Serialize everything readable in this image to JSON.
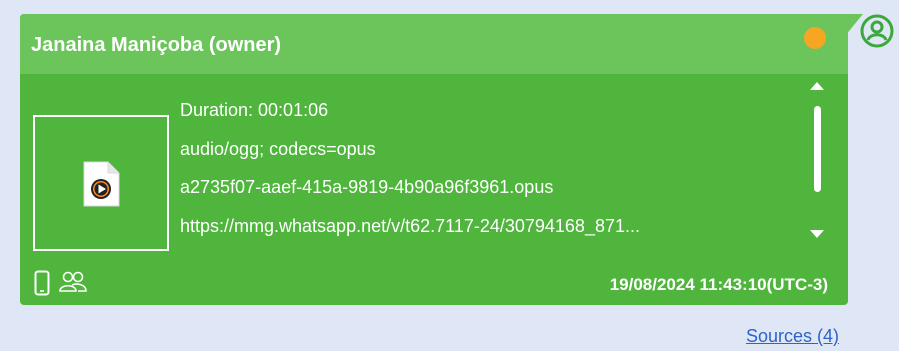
{
  "message": {
    "sender": "Janaina Maniçoba (owner)",
    "status_color": "#f6a623",
    "attachment": {
      "icon": "audio-file-play-icon",
      "details": [
        "Duration: 00:01:06",
        "audio/ogg; codecs=opus",
        "a2735f07-aaef-415a-9819-4b90a96f3961.opus",
        "https://mmg.whatsapp.net/v/t62.7117-24/30794168_871..."
      ]
    },
    "footer_icons": [
      "mobile-device-icon",
      "group-icon"
    ],
    "timestamp": "19/08/2024 11:43:10(UTC-3)"
  },
  "avatar_icon": "user-avatar-icon",
  "sources_link": "Sources (4)",
  "colors": {
    "bubble_body": "#4fb53c",
    "bubble_header": "#6cc55b",
    "background": "#dfe7f7",
    "link": "#2e63c7"
  }
}
